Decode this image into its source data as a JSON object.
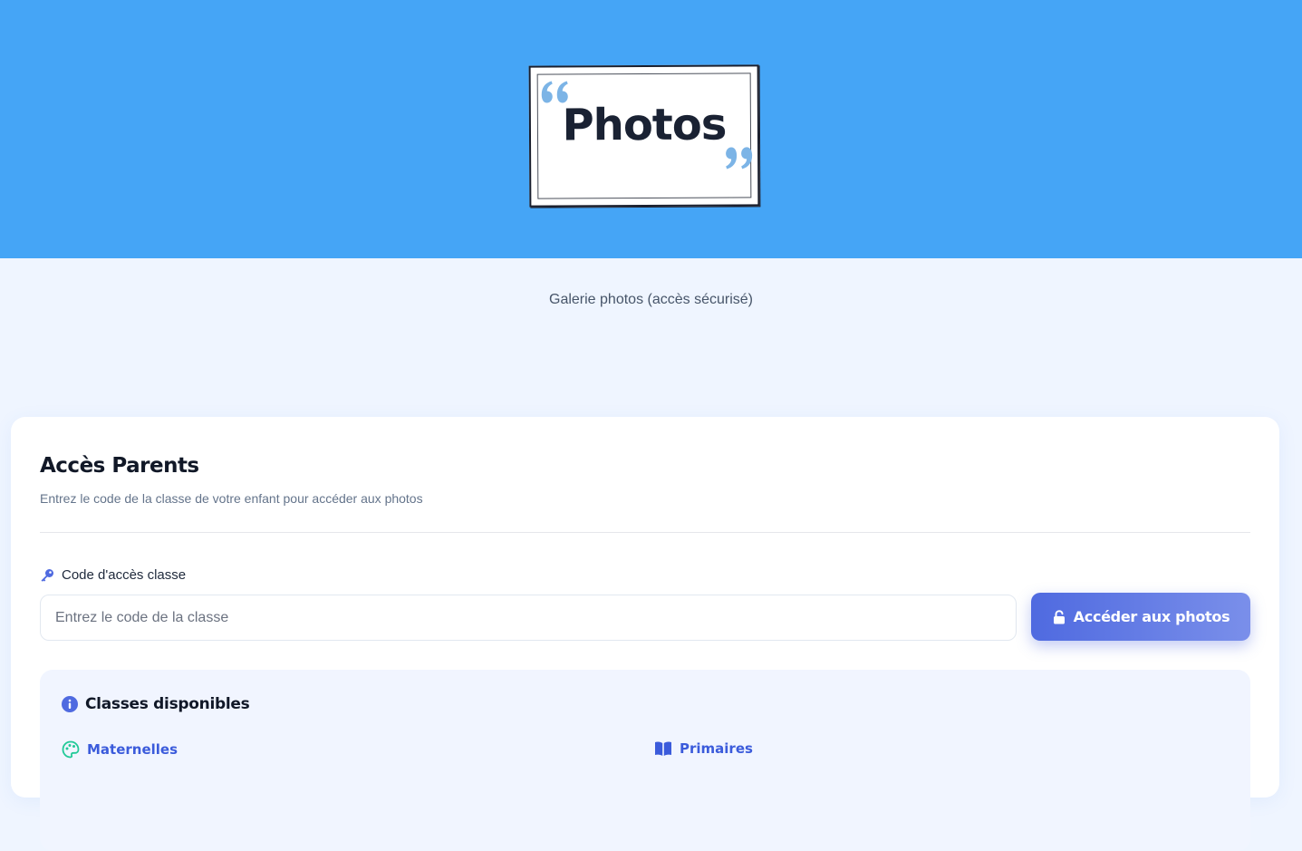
{
  "hero": {
    "title": "Photos",
    "background_color": "#45a5f6"
  },
  "subtitle": "Galerie photos (accès sécurisé)",
  "access_card": {
    "title": "Accès Parents",
    "description": "Entrez le code de la classe de votre enfant pour accéder aux photos",
    "field_label": "Code d'accès classe",
    "field_icon": "key-icon",
    "input_value": "",
    "input_placeholder": "Entrez le code de la classe",
    "button_label": "Accéder aux photos",
    "button_icon": "unlock-icon",
    "accent_color": "#4f6ae0"
  },
  "classes": {
    "title": "Classes disponibles",
    "title_icon": "info-circle-icon",
    "items": [
      {
        "label": "Maternelles",
        "icon": "palette-icon"
      },
      {
        "label": "Primaires",
        "icon": "book-icon"
      }
    ]
  }
}
